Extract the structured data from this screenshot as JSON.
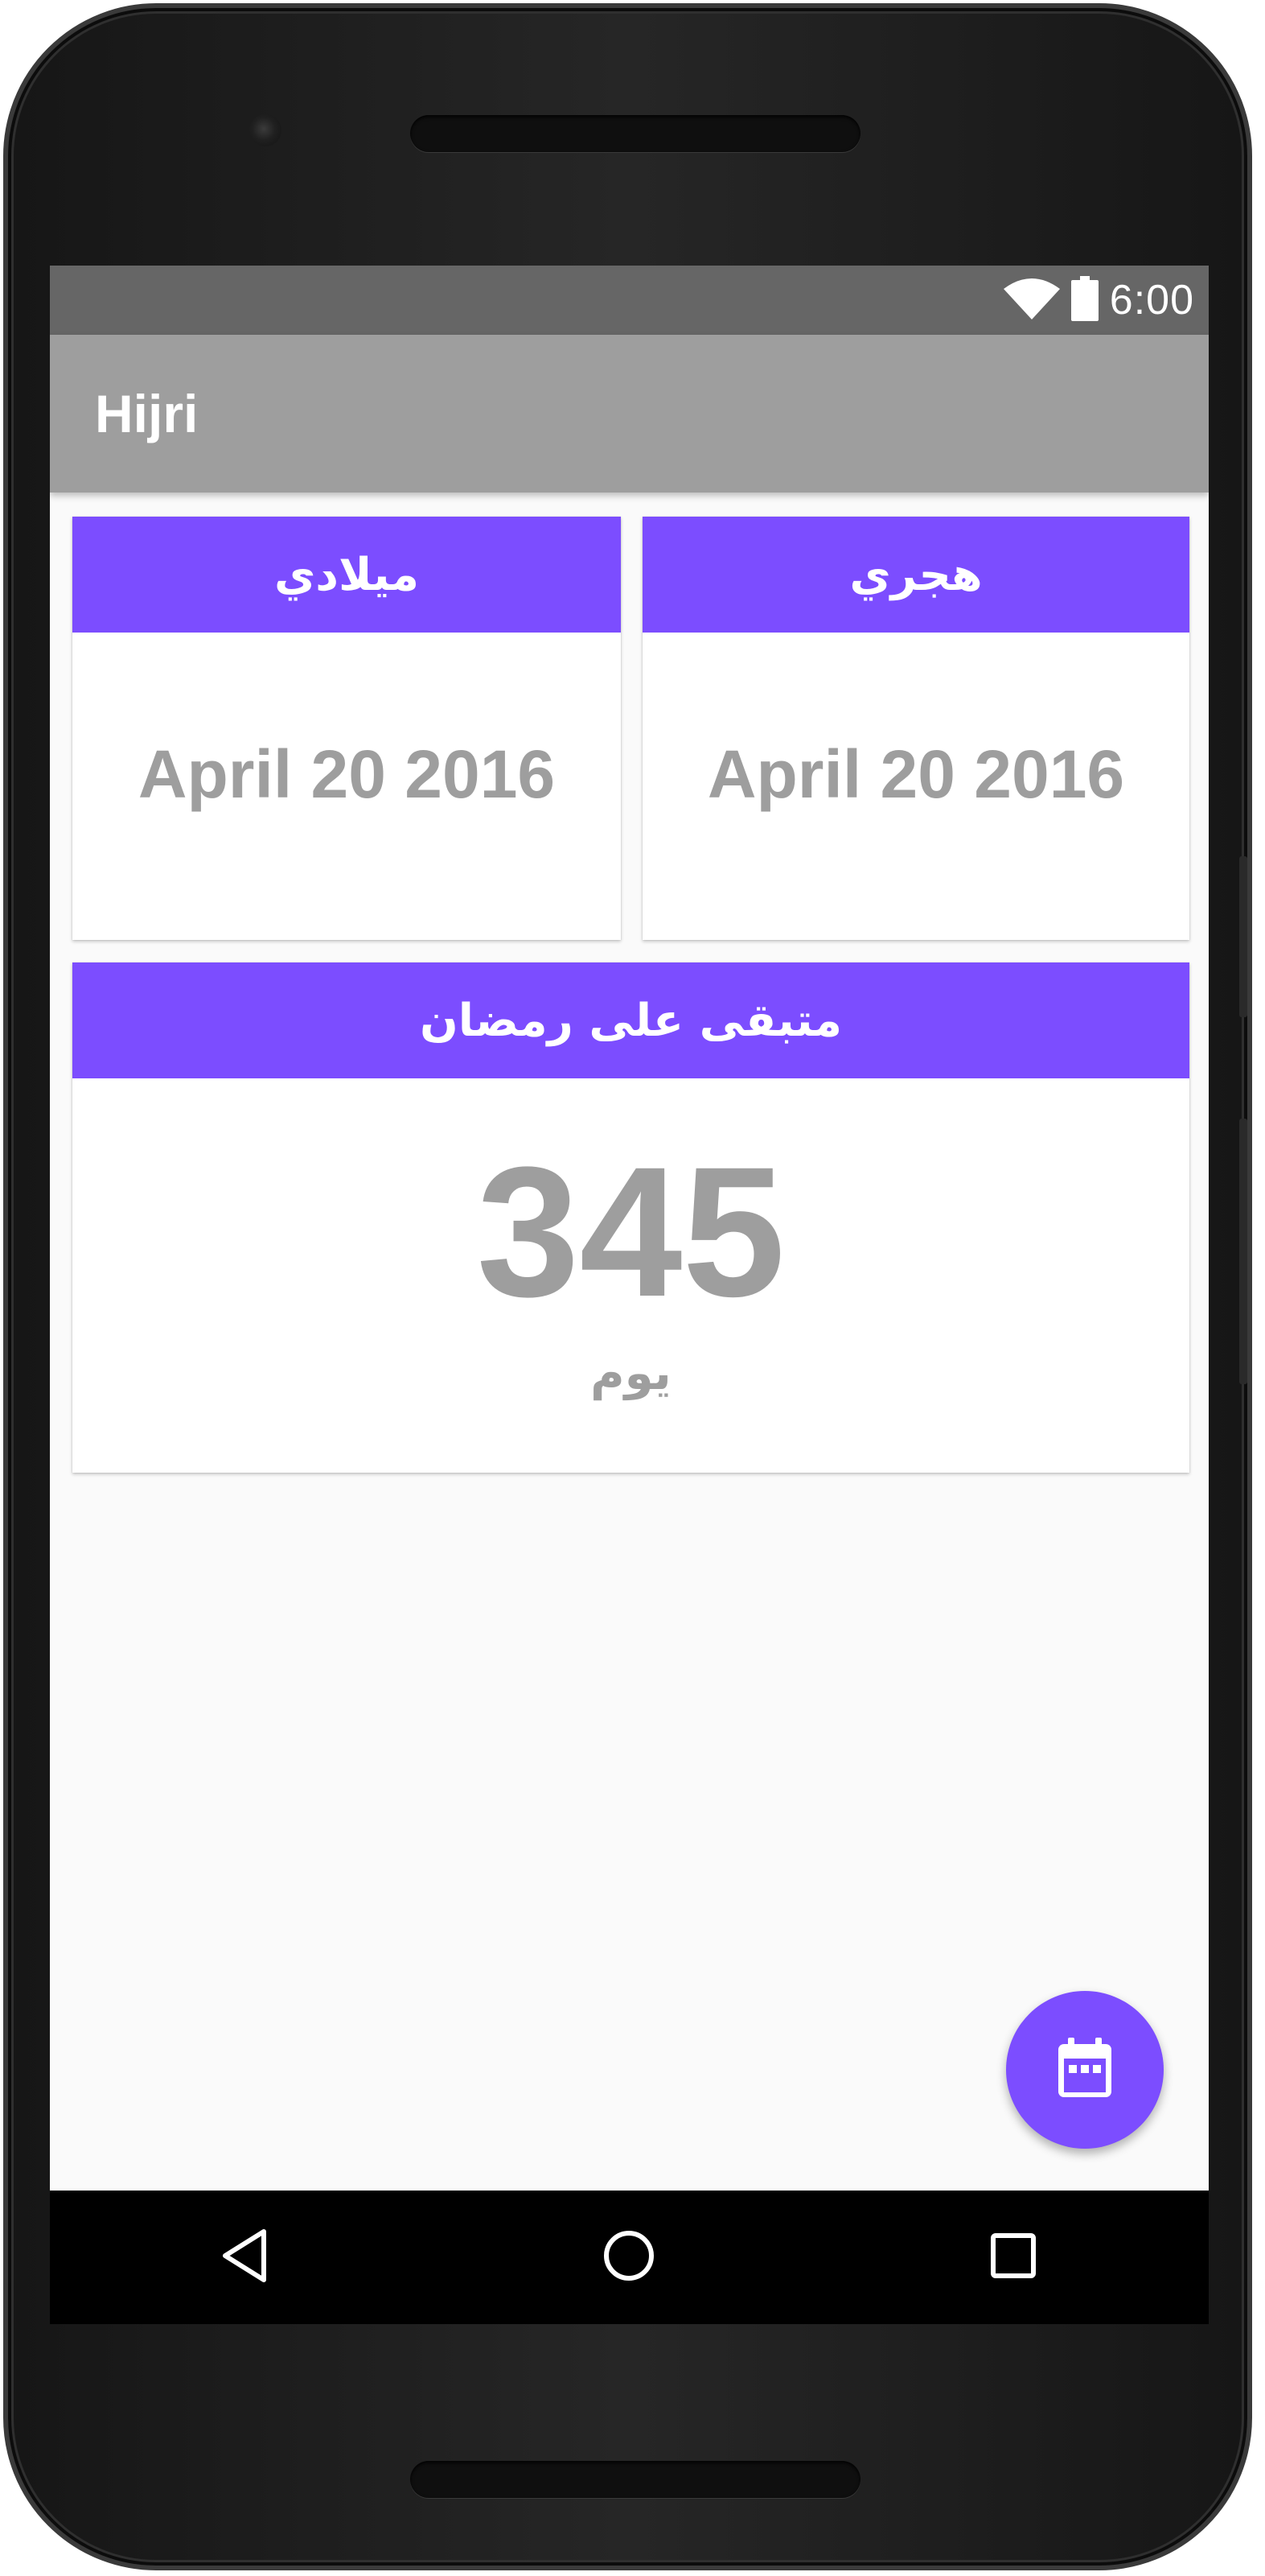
{
  "status_bar": {
    "time": "6:00",
    "icons": [
      "wifi-icon",
      "battery-icon"
    ]
  },
  "app_bar": {
    "title": "Hijri"
  },
  "cards": {
    "hijri": {
      "header": "هجري",
      "date": "April 20 2016"
    },
    "gregorian": {
      "header": "ميلادي",
      "date": "April 20 2016"
    },
    "countdown": {
      "header": "متبقى على رمضان",
      "value": "345",
      "unit": "يوم"
    }
  },
  "fab": {
    "icon": "calendar-icon"
  },
  "nav_bar": {
    "icons": [
      "back-icon",
      "home-icon",
      "recents-icon"
    ]
  },
  "colors": {
    "accent": "#7c4dff",
    "app_bar": "#9e9e9e",
    "status_bar": "#666666",
    "text_muted": "#9e9e9e"
  }
}
